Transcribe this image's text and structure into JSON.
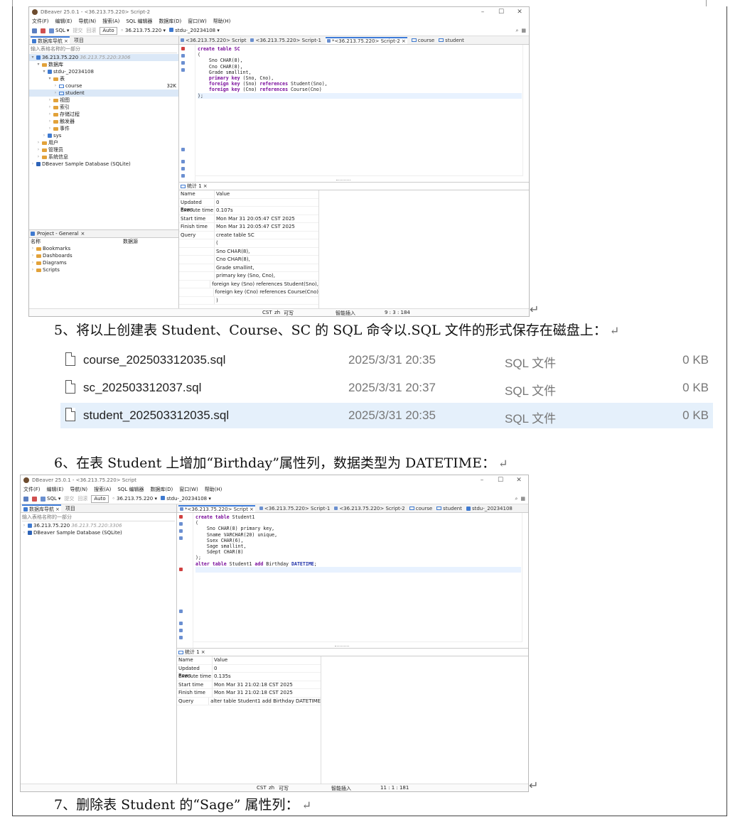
{
  "screen1": {
    "title": "DBeaver 25.0.1 - <36.213.75.220> Script-2",
    "menu": [
      "文件(F)",
      "编辑(E)",
      "导航(N)",
      "搜索(A)",
      "SQL 编辑器",
      "数据库(D)",
      "窗口(W)",
      "帮助(H)"
    ],
    "toolbar": {
      "sql": "SQL",
      "commit": "提交",
      "rollback": "回滚",
      "auto": "Auto",
      "server": "36.213.75.220",
      "schema": "stdu-_20234108"
    },
    "left_tabs": [
      "数据库导航",
      "项目"
    ],
    "filter_placeholder": "输入表格名称的一部分",
    "tree": [
      {
        "label": "36.213.75.220",
        "info": "36.213.75.220:3306"
      },
      {
        "label": "数据库"
      },
      {
        "label": "stdu-_20234108"
      },
      {
        "label": "表"
      },
      {
        "label": "course",
        "size": "32K"
      },
      {
        "label": "student"
      },
      {
        "label": "视图"
      },
      {
        "label": "索引"
      },
      {
        "label": "存储过程"
      },
      {
        "label": "触发器"
      },
      {
        "label": "事件"
      },
      {
        "label": "sys"
      },
      {
        "label": "用户"
      },
      {
        "label": "管理员"
      },
      {
        "label": "系统信息"
      },
      {
        "label": "DBeaver Sample Database (SQLite)"
      }
    ],
    "project": {
      "title": "Project - General",
      "col_name": "名称",
      "col_source": "数据源",
      "items": [
        "Bookmarks",
        "Dashboards",
        "Diagrams",
        "Scripts"
      ]
    },
    "editor_tabs": [
      "<36.213.75.220> Script",
      "<36.213.75.220> Script-1",
      "*<36.213.75.220> Script-2",
      "course",
      "student"
    ],
    "code": [
      "create table SC",
      "(",
      "    Sno CHAR(8),",
      "    Cno CHAR(8),",
      "    Grade smallint,",
      "    primary key (Sno, Cno),",
      "    foreign key (Sno) references Student(Sno),",
      "    foreign key (Cno) references Course(Cno)",
      ");"
    ],
    "results_tab": "统计 1",
    "grid_headers": [
      "Name",
      "Value"
    ],
    "grid": [
      [
        "Updated Rows",
        "0"
      ],
      [
        "Execute time",
        "0.107s"
      ],
      [
        "Start time",
        "Mon Mar 31 20:05:47 CST 2025"
      ],
      [
        "Finish time",
        "Mon Mar 31 20:05:47 CST 2025"
      ],
      [
        "Query",
        "create table SC"
      ],
      [
        "",
        "("
      ],
      [
        "",
        "   Sno CHAR(8),"
      ],
      [
        "",
        "   Cno CHAR(8),"
      ],
      [
        "",
        "   Grade smallint,"
      ],
      [
        "",
        "   primary key (Sno, Cno),"
      ],
      [
        "",
        "   foreign key (Sno) references Student(Sno),"
      ],
      [
        "",
        "   foreign key (Cno) references Course(Cno)"
      ],
      [
        "",
        ")"
      ]
    ],
    "status": {
      "tz": "CST",
      "lang": "zh",
      "mode": "可写",
      "insert": "智能插入",
      "pos": "9 : 3 : 184"
    }
  },
  "step5": "5、将以上创建表 Student、Course、SC 的 SQL 命令以.SQL 文件的形式保存在磁盘上：",
  "files": [
    {
      "name": "course_202503312035.sql",
      "date": "2025/3/31 20:35",
      "type": "SQL 文件",
      "size": "0 KB"
    },
    {
      "name": "sc_202503312037.sql",
      "date": "2025/3/31 20:37",
      "type": "SQL 文件",
      "size": "0 KB"
    },
    {
      "name": "student_202503312035.sql",
      "date": "2025/3/31 20:35",
      "type": "SQL 文件",
      "size": "0 KB"
    }
  ],
  "step6": "6、在表 Student 上增加“Birthday”属性列，数据类型为 DATETIME：",
  "screen2": {
    "title": "DBeaver 25.0.1 - <36.213.75.220> Script",
    "menu": [
      "文件(F)",
      "编辑(E)",
      "导航(N)",
      "搜索(A)",
      "SQL 编辑器",
      "数据库(D)",
      "窗口(W)",
      "帮助(H)"
    ],
    "toolbar": {
      "sql": "SQL",
      "commit": "提交",
      "rollback": "回滚",
      "auto": "Auto",
      "server": "36.213.75.220",
      "schema": "stdu-_20234108"
    },
    "left_tabs": [
      "数据库导航",
      "项目"
    ],
    "filter_placeholder": "输入表格名称的一部分",
    "tree": [
      {
        "label": "36.213.75.220",
        "info": "36.213.75.220:3306"
      },
      {
        "label": "DBeaver Sample Database (SQLite)"
      }
    ],
    "editor_tabs": [
      "*<36.213.75.220> Script",
      "<36.213.75.220> Script-1",
      "<36.213.75.220> Script-2",
      "course",
      "student",
      "stdu-_20234108"
    ],
    "code": [
      "create table Student1",
      "(",
      "    Sno CHAR(8) primary key,",
      "    Sname VARCHAR(20) unique,",
      "    Ssex CHAR(6),",
      "    Sage smallint,",
      "    Sdept CHAR(8)",
      ");",
      "",
      "alter table Student1 add Birthday DATETIME;"
    ],
    "results_tab": "统计 1",
    "grid_headers": [
      "Name",
      "Value"
    ],
    "grid": [
      [
        "Updated Rows",
        "0"
      ],
      [
        "Execute time",
        "0.135s"
      ],
      [
        "Start time",
        "Mon Mar 31 21:02:18 CST 2025"
      ],
      [
        "Finish time",
        "Mon Mar 31 21:02:18 CST 2025"
      ],
      [
        "Query",
        "alter table Student1 add Birthday DATETIME"
      ]
    ],
    "status": {
      "tz": "CST",
      "lang": "zh",
      "mode": "可写",
      "insert": "智能插入",
      "pos": "11 : 1 : 181"
    }
  },
  "step7": "7、删除表 Student 的“Sage” 属性列：",
  "marks": {
    "return": "↵"
  }
}
